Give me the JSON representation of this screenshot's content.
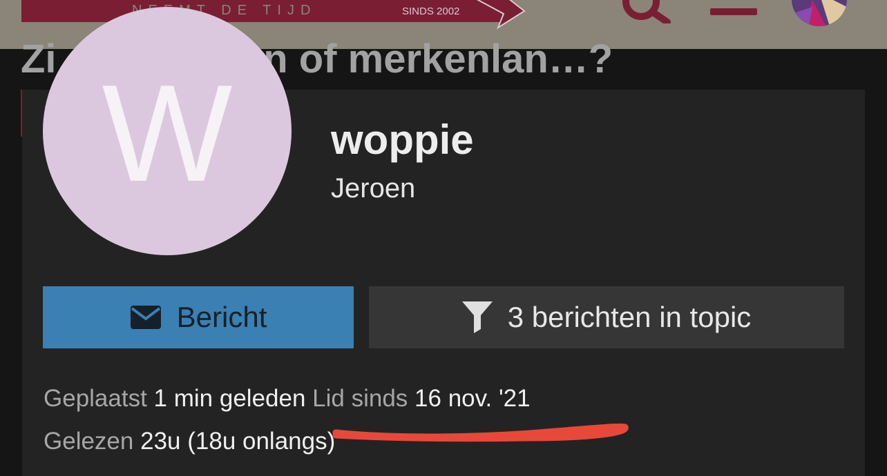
{
  "header": {
    "slogan": "NEEMT DE TIJD",
    "since": "SINDS 2002",
    "colors": {
      "brand": "#7a1e34",
      "bar": "#8a8578"
    }
  },
  "page": {
    "title": "Zi… …logelan of merkenlan…?"
  },
  "profile": {
    "avatar_letter": "W",
    "username": "woppie",
    "real_name": "Jeroen",
    "avatar_color": "#dcc8de"
  },
  "buttons": {
    "message_label": "Bericht",
    "message_icon": "envelope-icon",
    "filter_label": "3 berichten in topic",
    "filter_icon": "filter-icon"
  },
  "meta": {
    "posted_label": "Geplaatst",
    "posted_value": "1 min geleden",
    "member_label": "Lid sinds",
    "member_value": "16 nov. '21",
    "read_label": "Gelezen",
    "read_value": "23u (18u onlangs)"
  }
}
